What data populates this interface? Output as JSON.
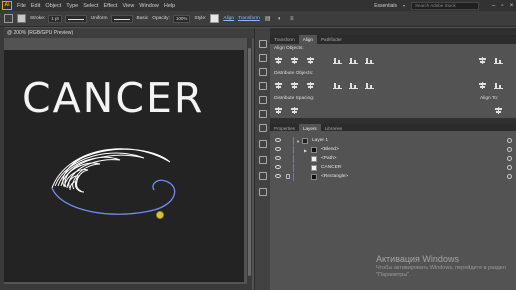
{
  "app": {
    "logo": "Ai",
    "menu": [
      "File",
      "Edit",
      "Object",
      "Type",
      "Select",
      "Effect",
      "View",
      "Window",
      "Help"
    ],
    "workspace": "Essentials",
    "search_placeholder": "Search Adobe Stock",
    "window_controls": [
      "minimize",
      "maximize",
      "close"
    ]
  },
  "control_bar": {
    "stroke_label": "Stroke:",
    "stroke_weight": "1 pt",
    "profile": "Uniform",
    "brush": "Basic",
    "opacity_label": "Opacity:",
    "opacity_value": "100%",
    "style_label": "Style:",
    "align_link": "Align",
    "transform_link": "Transform"
  },
  "document": {
    "tab_title": "@ 200% (RGB/GPU Preview)",
    "artboard_text": "CANCER"
  },
  "align_panel": {
    "tabs": [
      "Transform",
      "Align",
      "Pathfinder"
    ],
    "active_tab": "Align",
    "sections": [
      "Align Objects:",
      "Distribute Objects:",
      "Distribute Spacing:"
    ],
    "align_to_label": "Align To:"
  },
  "layers_panel": {
    "tabs": [
      "Properties",
      "Layers",
      "Libraries"
    ],
    "active_tab": "Layers",
    "rows": [
      {
        "name": "Layer 1",
        "level": 0
      },
      {
        "name": "<Blend>",
        "level": 1
      },
      {
        "name": "<Path>",
        "level": 1
      },
      {
        "name": "CANCER",
        "level": 1
      },
      {
        "name": "<Rectangle>",
        "level": 1
      }
    ]
  },
  "activation": {
    "title": "Активация Windows",
    "subtitle": "Чтобы активировать Windows, перейдите в раздел \"Параметры\"."
  },
  "colors": {
    "accent_layer": "#4f7bff",
    "artboard": "#232323",
    "logo_orange": "#ff9a00"
  }
}
